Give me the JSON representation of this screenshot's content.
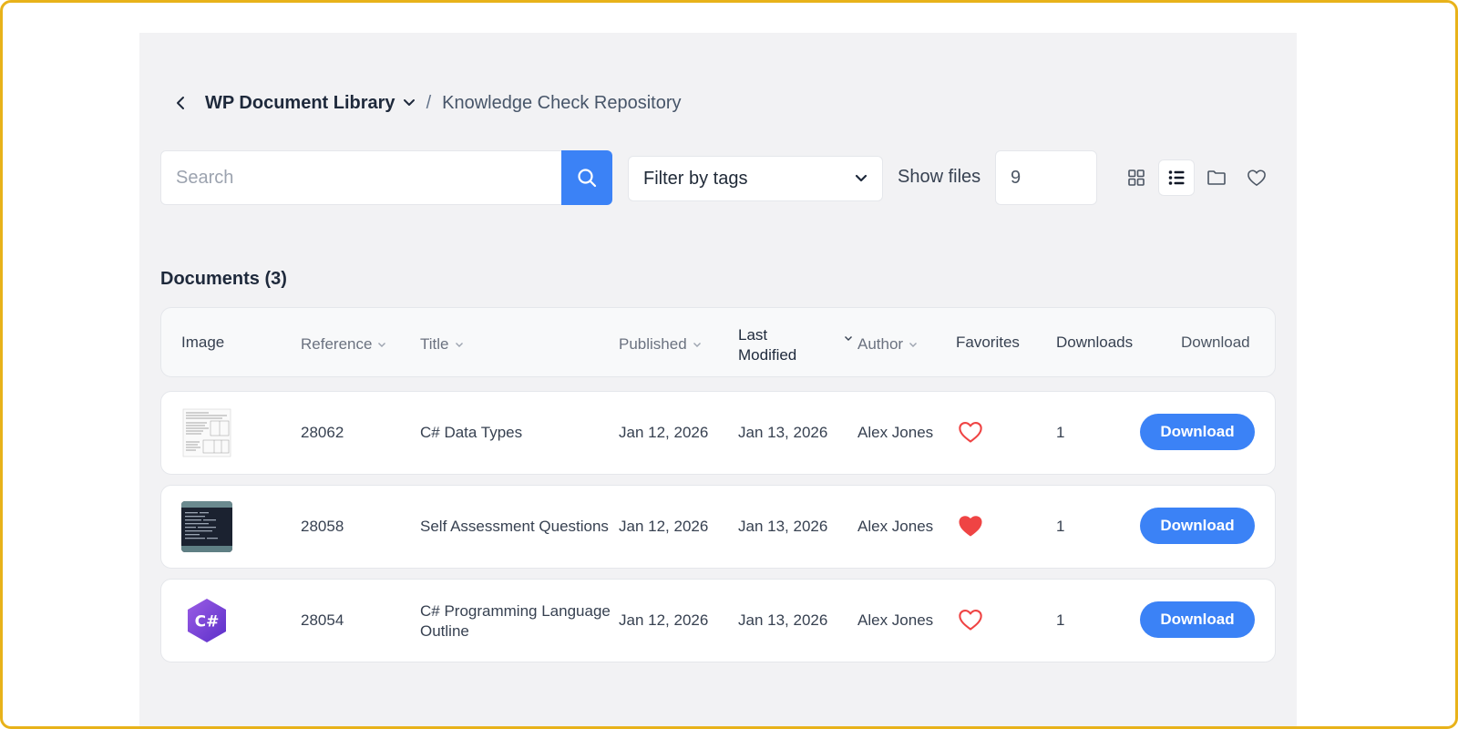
{
  "breadcrumb": {
    "root": "WP Document Library",
    "separator": "/",
    "current": "Knowledge Check Repository"
  },
  "toolbar": {
    "search_placeholder": "Search",
    "search_value": "",
    "filter_label": "Filter by tags",
    "show_files_label": "Show files",
    "show_files_value": "9",
    "views": [
      "grid-view-icon",
      "list-view-icon",
      "folder-view-icon",
      "favorites-view-icon"
    ],
    "active_view": "list-view-icon"
  },
  "documents": {
    "heading": "Documents (3)",
    "columns": {
      "image": "Image",
      "reference": "Reference",
      "title": "Title",
      "published": "Published",
      "last_modified_1": "Last",
      "last_modified_2": "Modified",
      "author": "Author",
      "favorites": "Favorites",
      "downloads": "Downloads",
      "download": "Download"
    },
    "rows": [
      {
        "reference": "28062",
        "title": "C# Data Types",
        "title_line2": "",
        "published": "Jan 12, 2026",
        "modified": "Jan 13, 2026",
        "author": "Alex Jones",
        "favorite": false,
        "downloads": "1",
        "button": "Download"
      },
      {
        "reference": "28058",
        "title": "Self Assessment Questions",
        "title_line2": "",
        "published": "Jan 12, 2026",
        "modified": "Jan 13, 2026",
        "author": "Alex Jones",
        "favorite": true,
        "downloads": "1",
        "button": "Download"
      },
      {
        "reference": "28054",
        "title": "C# Programming Language",
        "title_line2": "Outline",
        "published": "Jan 12, 2026",
        "modified": "Jan 13, 2026",
        "author": "Alex Jones",
        "favorite": false,
        "downloads": "1",
        "button": "Download",
        "logo_text": "C#"
      }
    ]
  },
  "colors": {
    "accent": "#3b82f6",
    "heart": "#ef4444",
    "frame": "#e8b21a"
  }
}
